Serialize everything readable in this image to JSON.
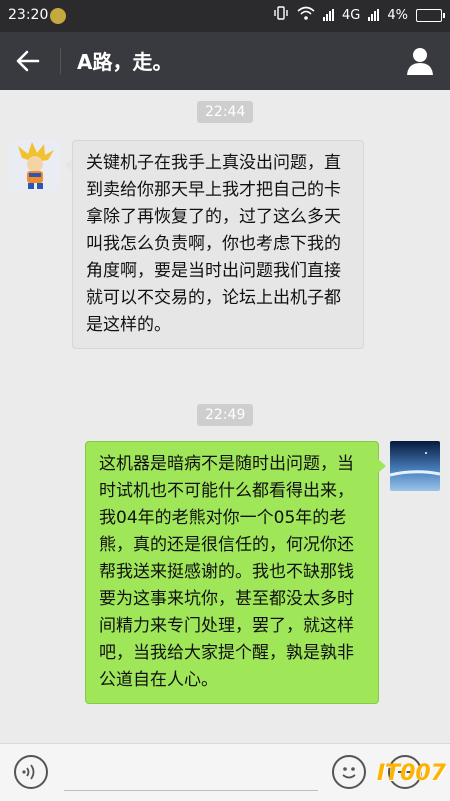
{
  "status": {
    "time": "23:20",
    "network": "4G",
    "battery": "4%"
  },
  "header": {
    "title": "A路，走。"
  },
  "messages": [
    {
      "time": "22:44",
      "direction": "incoming",
      "text": "关键机子在我手上真没出问题，直到卖给你那天早上我才把自己的卡拿除了再恢复了的，过了这么多天叫我怎么负责啊，你也考虑下我的角度啊，要是当时出问题我们直接就可以不交易的，论坛上出机子都是这样的。"
    },
    {
      "time": "22:49",
      "direction": "outgoing",
      "text": "这机器是暗病不是随时出问题，当时试机也不可能什么都看得出来，我04年的老熊对你一个05年的老熊，真的还是很信任的，何况你还帮我送来挺感谢的。我也不缺那钱要为这事来坑你，甚至都没太多时间精力来专门处理，罢了，就这样吧，当我给大家提个醒，孰是孰非公道自在人心。"
    }
  ],
  "input": {
    "placeholder": ""
  },
  "watermark": "IT007",
  "colors": {
    "statusbar": "#2b2b2d",
    "titlebar": "#393a3f",
    "chat_bg": "#ebebeb",
    "incoming_bubble": "#e6e6e6",
    "outgoing_bubble": "#9fe658"
  }
}
